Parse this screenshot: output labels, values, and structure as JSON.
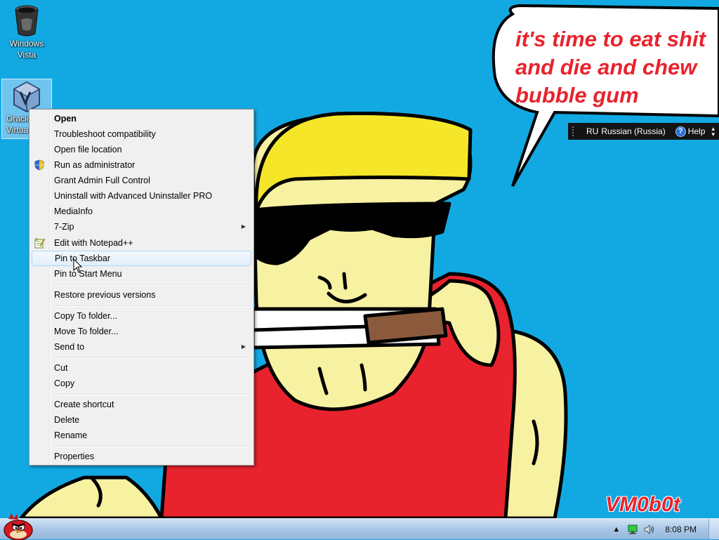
{
  "desktop": {
    "icons": [
      {
        "label_line1": "Windows",
        "label_line2": "Vista"
      },
      {
        "label_line1": "Oracle",
        "label_line2": "Virtua"
      }
    ],
    "wallpaper": {
      "speech_line1": "it's time to eat shit",
      "speech_line2": "and die and chew",
      "speech_line3": "bubble gum",
      "signature": "VM0b0t"
    }
  },
  "language_bar": {
    "code": "RU",
    "language": "Russian (Russia)",
    "help_label": "Help"
  },
  "context_menu": {
    "items": [
      {
        "label": "Open"
      },
      {
        "label": "Troubleshoot compatibility"
      },
      {
        "label": "Open file location"
      },
      {
        "label": "Run as administrator",
        "icon": "uac-shield-icon"
      },
      {
        "label": "Grant Admin Full Control"
      },
      {
        "label": "Uninstall with Advanced Uninstaller PRO"
      },
      {
        "label": "MediaInfo"
      },
      {
        "label": "7-Zip"
      },
      {
        "label": "Edit with Notepad++",
        "icon": "notepad-plus-plus-icon"
      },
      {
        "label": "Pin to Taskbar"
      },
      {
        "label": "Pin to Start Menu"
      },
      {
        "label": "Restore previous versions"
      },
      {
        "label": "Copy To folder..."
      },
      {
        "label": "Move To folder..."
      },
      {
        "label": "Send to"
      },
      {
        "label": "Cut"
      },
      {
        "label": "Copy"
      },
      {
        "label": "Create shortcut"
      },
      {
        "label": "Delete"
      },
      {
        "label": "Rename"
      },
      {
        "label": "Properties"
      }
    ],
    "highlighted": "Pin to Taskbar"
  },
  "taskbar": {
    "clock": "8:08 PM",
    "tray_icons": [
      "show-hidden-icons-arrow",
      "network-icon",
      "volume-icon"
    ]
  },
  "colors": {
    "desktop_bg": "#12a9e3",
    "wallpaper_text": "#e8232d",
    "menu_highlight": "#e2eefa"
  }
}
